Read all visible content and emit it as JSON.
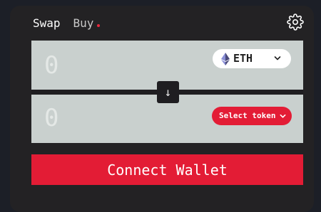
{
  "tabs": {
    "swap": "Swap",
    "buy": "Buy"
  },
  "icons": {
    "settings": "gear-icon",
    "swap_direction": "arrow-down-icon",
    "token": "eth-logo-icon",
    "chevron": "chevron-down-icon"
  },
  "from": {
    "amount_placeholder": "0",
    "token_label": "ETH"
  },
  "to": {
    "amount_placeholder": "0",
    "select_label": "Select token"
  },
  "swap_arrow": "↓",
  "connect_label": "Connect Wallet",
  "colors": {
    "accent": "#e31c35",
    "panel": "#232224",
    "input_bg": "#c9d0ce",
    "page_bg": "#1c1f27"
  }
}
